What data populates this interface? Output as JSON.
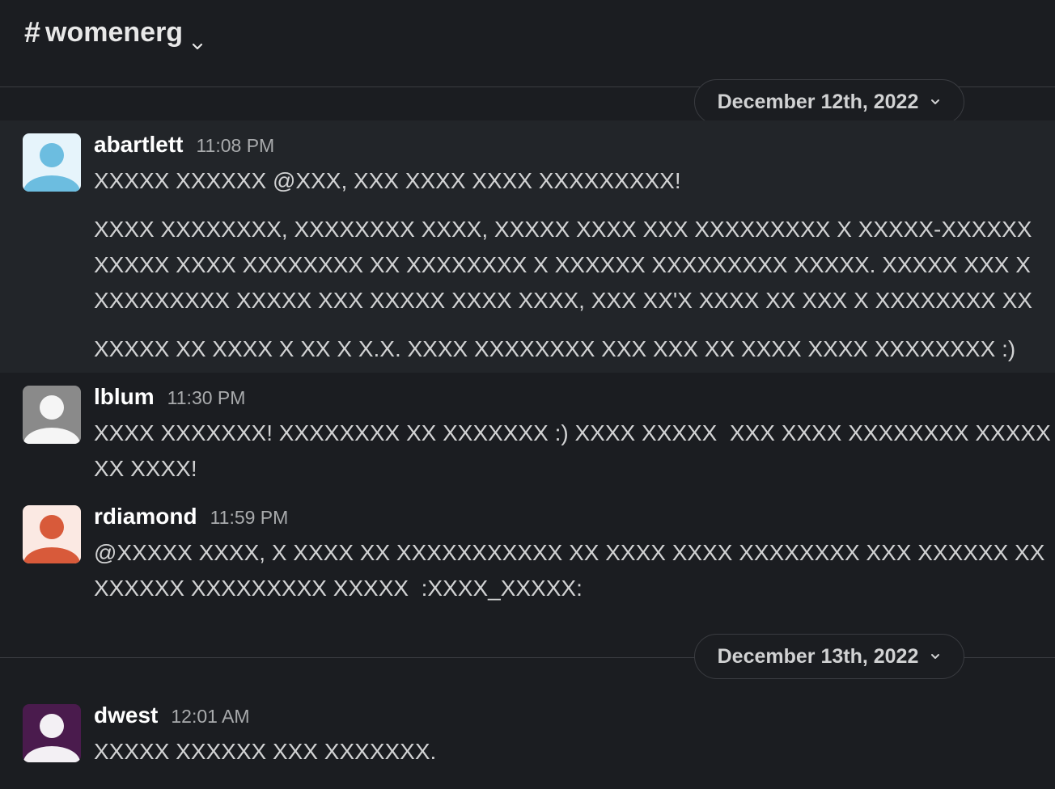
{
  "channel": {
    "name": "womenerg"
  },
  "dates": [
    "December 12th, 2022",
    "December 13th, 2022"
  ],
  "messages": [
    {
      "user": "abartlett",
      "time": "11:08 PM",
      "avatar_color": "#6cbde0",
      "avatar_bg": "#e6f4fb",
      "lines": [
        "XXXXX XXXXXX @XXX, XXX XXXX XXXX XXXXXXXXX!",
        "XXXX XXXXXXXX, XXXXXXXX XXXX, XXXXX XXXX XXX XXXXXXXXX X XXXXX-XXXXXX",
        "XXXXX XXXX XXXXXXXX XX XXXXXXXX X XXXXXX XXXXXXXXX XXXXX. XXXXX XXX X",
        "XXXXXXXXX XXXXX XXX XXXXX XXXX XXXX, XXX XX'X XXXX XX XXX X XXXXXXXX XX",
        "XXXXX XX XXXX X XX X X.X. XXXX XXXXXXXX XXX XXX XX XXXX XXXX XXXXXXXX :)"
      ]
    },
    {
      "user": "lblum",
      "time": "11:30 PM",
      "avatar_color": "#f5f5f5",
      "avatar_bg": "#8a8a8a",
      "lines": [
        "XXXX XXXXXXX! XXXXXXXX XX XXXXXXX :) XXXX XXXXX  XXX XXXX XXXXXXXX XXXXX",
        "XX XXXX!"
      ]
    },
    {
      "user": "rdiamond",
      "time": "11:59 PM",
      "avatar_color": "#d85a3a",
      "avatar_bg": "#fbe9e3",
      "lines": [
        "@XXXXX XXXX, X XXXX XX XXXXXXXXXXX XX XXXX XXXX XXXXXXXX XXX XXXXXX XX",
        "XXXXXX XXXXXXXXX XXXXX  :XXXX_XXXXX:"
      ]
    },
    {
      "user": "dwest",
      "time": "12:01 AM",
      "avatar_color": "#f3f0f4",
      "avatar_bg": "#4a1b4d",
      "lines": [
        "XXXXX XXXXXX XXX XXXXXXX."
      ]
    }
  ]
}
